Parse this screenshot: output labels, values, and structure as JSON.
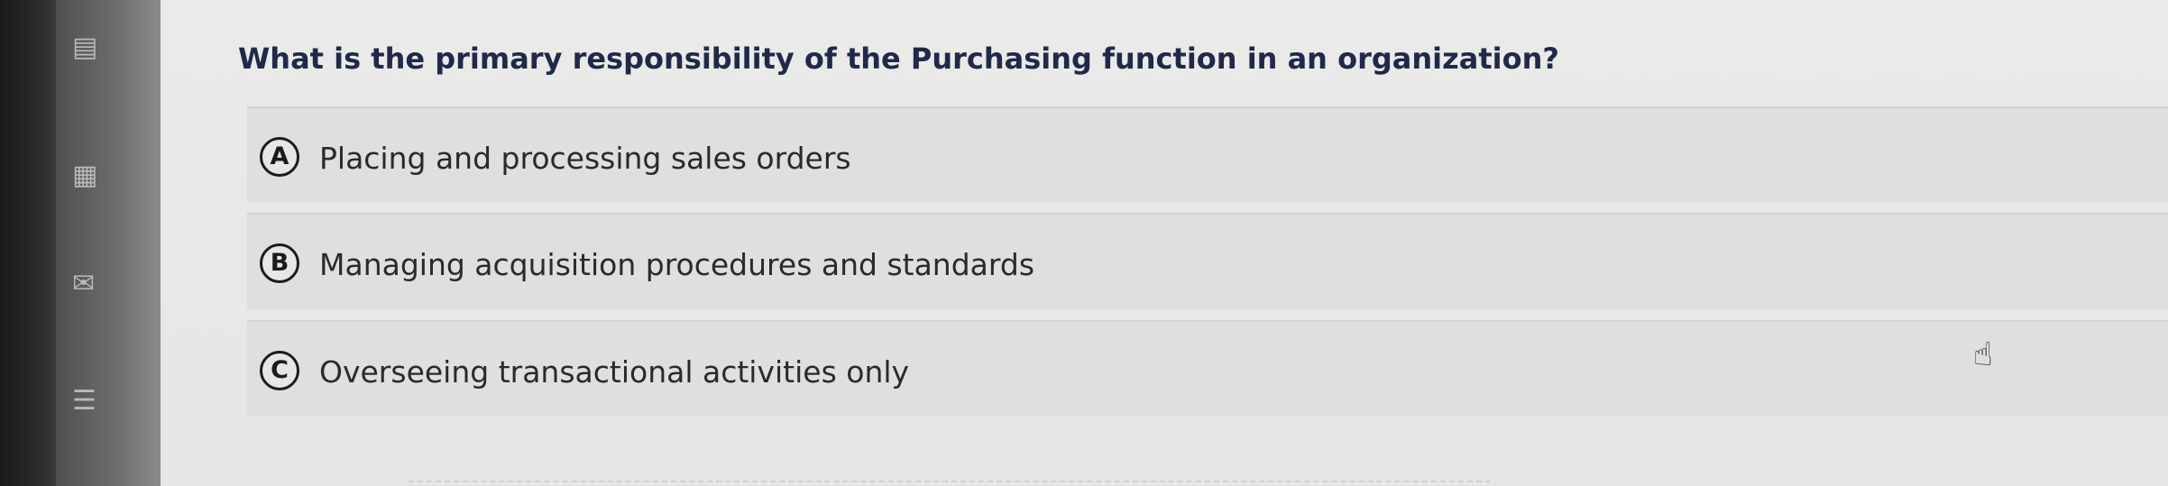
{
  "question": {
    "text": "What is the primary responsibility of the Purchasing function in an organization?"
  },
  "options": [
    {
      "letter": "A",
      "text": "Placing and processing sales orders"
    },
    {
      "letter": "B",
      "text": "Managing acquisition procedures and standards"
    },
    {
      "letter": "C",
      "text": "Overseeing transactional activities only"
    }
  ],
  "sidebar": {
    "icons": [
      "document-icon",
      "calculator-icon",
      "mail-icon",
      "list-icon"
    ]
  },
  "cursor": {
    "icon": "pointer-hand-icon"
  }
}
